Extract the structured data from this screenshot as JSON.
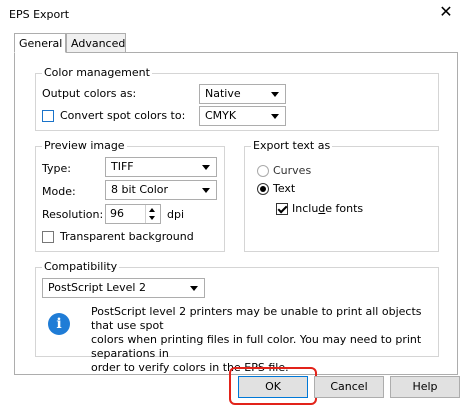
{
  "window": {
    "title": "EPS Export",
    "close_glyph": "✕"
  },
  "tabs": [
    {
      "label": "General",
      "active": true
    },
    {
      "label": "Advanced",
      "active": false
    }
  ],
  "color_management": {
    "group_label": "Color management",
    "output_label": "Output colors as:",
    "output_value": "Native",
    "convert_label": "Convert spot colors to:",
    "convert_checked": false,
    "convert_value": "CMYK"
  },
  "preview_image": {
    "group_label": "Preview image",
    "type_label": "Type:",
    "type_value": "TIFF",
    "mode_label": "Mode:",
    "mode_value": "8 bit Color",
    "resolution_label": "Resolution:",
    "resolution_value": "96",
    "resolution_unit": "dpi",
    "transparent_label": "Transparent background",
    "transparent_checked": false
  },
  "export_text": {
    "group_label": "Export text as",
    "curves_label": "Curves",
    "text_label": "Text",
    "selected": "Text",
    "include_fonts_label_pre": "Inclu",
    "include_fonts_label_acc": "d",
    "include_fonts_label_post": "e fonts",
    "include_fonts_checked": true
  },
  "compatibility": {
    "group_label": "Compatibility",
    "value": "PostScript Level 2",
    "info_lines": [
      "PostScript level 2 printers may be unable to print all objects that use spot",
      "colors when printing files in full color. You may need to print separations in",
      "order to verify colors in the EPS file."
    ]
  },
  "buttons": {
    "ok": "OK",
    "cancel": "Cancel",
    "help": "Help"
  },
  "colors": {
    "highlight": "#e2231a",
    "info_blue": "#1f7cd6",
    "checkbox_blue": "#1a73c9"
  }
}
